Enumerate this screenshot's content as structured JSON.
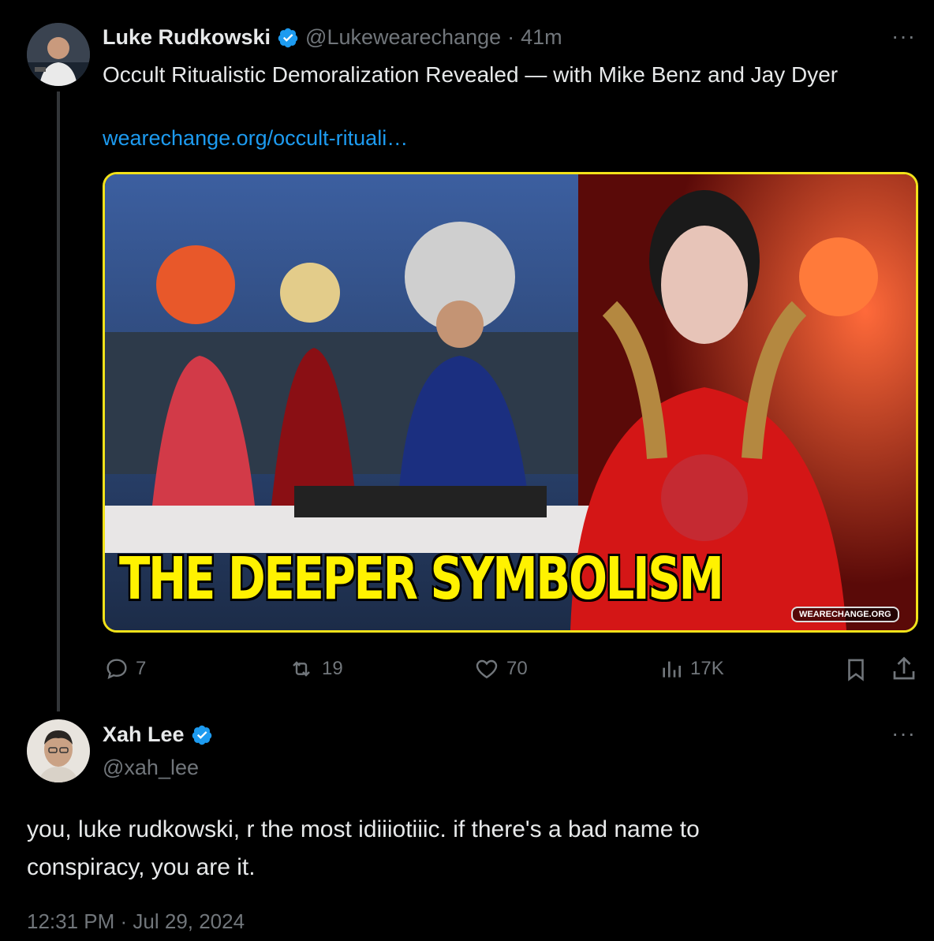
{
  "parent_tweet": {
    "author_name": "Luke Rudkowski",
    "handle": "@Lukewearechange",
    "separator": "·",
    "time_ago": "41m",
    "text": "Occult Ritualistic Demoralization Revealed — with Mike Benz and Jay Dyer",
    "link": "wearechange.org/occult-rituali…",
    "thumbnail": {
      "headline": "THE DEEPER SYMBOLISM",
      "watermark": "WEARECHANGE.ORG",
      "border_color": "#f2e21a",
      "text_color": "#fff200"
    },
    "actions": {
      "replies": "7",
      "retweets": "19",
      "likes": "70",
      "views": "17K"
    },
    "more_icon": "more-horizontal-icon"
  },
  "reply_tweet": {
    "author_name": "Xah Lee",
    "handle": "@xah_lee",
    "text_line1": "you, luke rudkowski, r the most idiiiotiiic. if there's a bad name to",
    "text_line2": "conspiracy, you are it.",
    "timestamp": "12:31 PM · Jul 29, 2024",
    "more_icon": "more-horizontal-icon"
  },
  "colors": {
    "background": "#000000",
    "accent": "#1d9bf0",
    "muted": "#71767b",
    "text": "#e7e9ea"
  }
}
